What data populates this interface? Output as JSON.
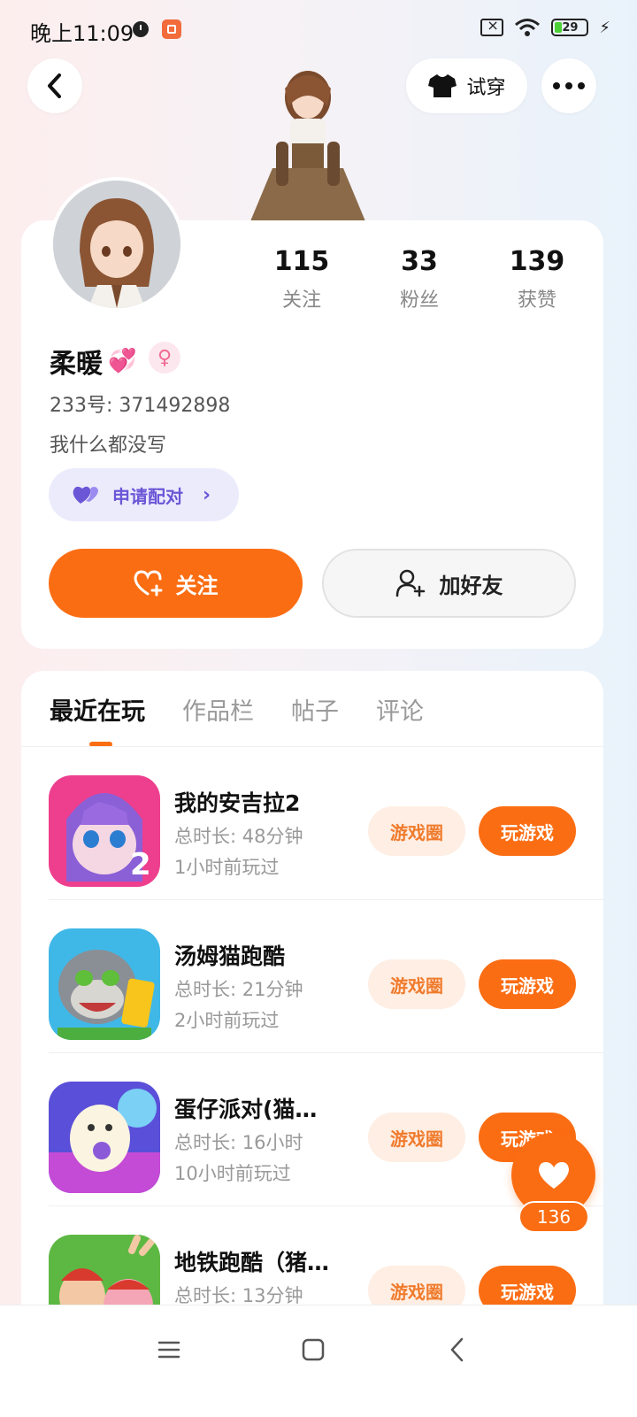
{
  "status_bar": {
    "time": "晚上11:09",
    "battery": "29"
  },
  "header": {
    "tryon_label": "试穿"
  },
  "profile": {
    "stats": [
      {
        "num": "115",
        "label": "关注"
      },
      {
        "num": "33",
        "label": "粉丝"
      },
      {
        "num": "139",
        "label": "获赞"
      }
    ],
    "nickname": "柔暖",
    "nickname_emoji": "💞",
    "gender_symbol": "♀",
    "user_id": "233号: 371492898",
    "bio": "我什么都没写",
    "pair_label": "申请配对",
    "follow_label": "关注",
    "addfriend_label": "加好友"
  },
  "tabs": [
    "最近在玩",
    "作品栏",
    "帖子",
    "评论"
  ],
  "games": [
    {
      "name": "我的安吉拉2",
      "duration": "总时长: 48分钟",
      "last_played": "1小时前玩过",
      "circle_label": "游戏圈",
      "play_label": "玩游戏"
    },
    {
      "name": "汤姆猫跑酷",
      "duration": "总时长: 21分钟",
      "last_played": "2小时前玩过",
      "circle_label": "游戏圈",
      "play_label": "玩游戏"
    },
    {
      "name": "蛋仔派对(猫…",
      "duration": "总时长: 16小时",
      "last_played": "10小时前玩过",
      "circle_label": "游戏圈",
      "play_label": "玩游戏"
    },
    {
      "name": "地铁跑酷（猪…",
      "duration": "总时长: 13分钟",
      "last_played": "",
      "circle_label": "游戏圈",
      "play_label": "玩游戏"
    }
  ],
  "like_count": "136",
  "colors": {
    "accent": "#fb6d13",
    "pair": "#6b56d6"
  }
}
